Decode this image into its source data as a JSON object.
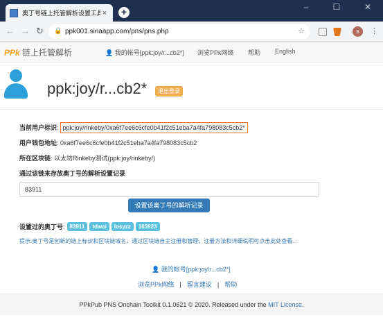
{
  "browser": {
    "tab_title": "奥丁号链上托管解析设置工具",
    "url": "ppk001.sinaapp.com/pns/pns.php",
    "avatar_letter": "s"
  },
  "nav": {
    "brand_prefix": "PPk",
    "brand_text": "链上托管解析",
    "user_link": "我的帐号[ppk:joy/r...cb2*]",
    "browse": "浏览PPk网络",
    "help": "帮助",
    "lang": "English"
  },
  "profile": {
    "name": "ppk:joy/r...cb2*",
    "logout": "退出登录"
  },
  "form": {
    "id_label": "当前用户标识",
    "id_value": "ppk:joy/rinkeby/0xa6f7ee6c6cfe0b41f2c51eba7a4fa798083c5cb2*",
    "wallet_label": "用户钱包地址",
    "wallet_value": "0xa6f7ee6c6cfe0b41f2c51eba7a4fa798083c5cb2",
    "chain_label": "所在区块链",
    "chain_value": "以太坊Rinkeby测试(ppk:joy/rinkeby/)",
    "intro": "通过该链来存放奥丁号的解析设置记录",
    "input_value": "83911",
    "submit": "设置该奥丁号的解析记录",
    "used_label": "设置过的奥丁号",
    "used_tags": [
      "83911",
      "tdwai",
      "losyzz",
      "105923"
    ],
    "hint": "提示:奥丁号是创新的链上标识和区块链域名，通过区块链自主注册和管理，注册方法和详细说明可点击此处查看..."
  },
  "footer_links": {
    "user": "我的帐号[ppk:joy/r...cb2*]",
    "browse": "浏览PPk网络",
    "feedback": "留言建议",
    "help": "帮助"
  },
  "footer": {
    "text": "PPkPub PNS Onchain Toolkit 0.1.0621 © 2020. Released under the ",
    "license": "MIT License",
    "end": "."
  }
}
